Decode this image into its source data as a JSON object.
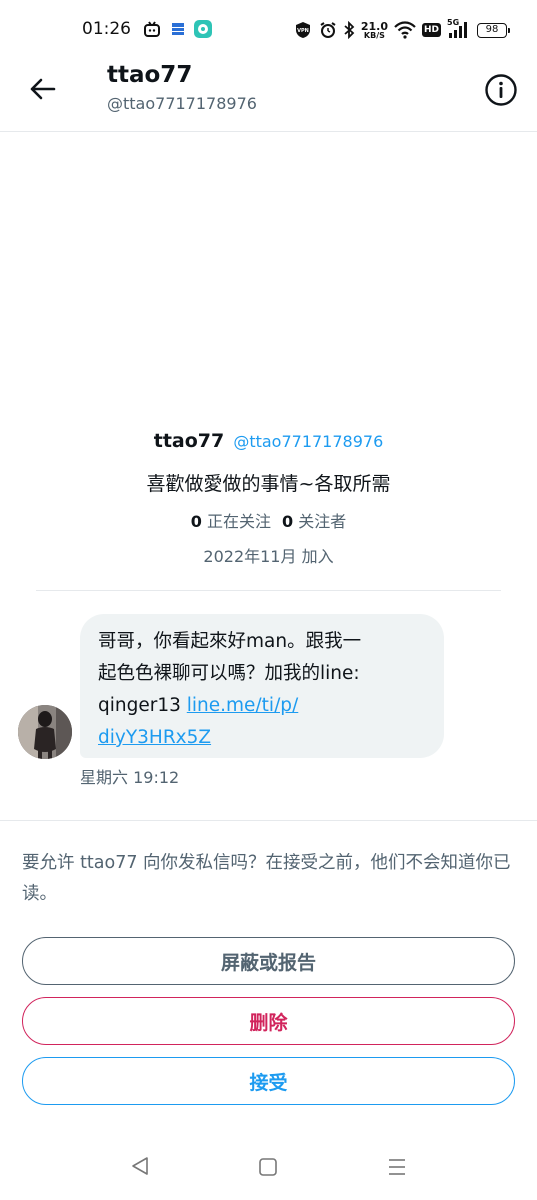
{
  "status_bar": {
    "time": "01:26",
    "net_speed_value": "21.0",
    "net_speed_unit": "KB/S",
    "hd_label": "HD",
    "signal_label": "5G",
    "battery": "98"
  },
  "header": {
    "name": "ttao77",
    "handle": "@ttao7717178976"
  },
  "profile": {
    "name": "ttao77",
    "handle": "@ttao7717178976",
    "bio": "喜歡做愛做的事情~各取所需",
    "following_count": "0",
    "following_label": "正在关注",
    "followers_count": "0",
    "followers_label": "关注者",
    "joined": "2022年11月 加入"
  },
  "message": {
    "text_line1": "哥哥，你看起來好man。跟我一",
    "text_line2": "起色色裸聊可以嗎？加我的line:",
    "text_line3_prefix": "qinger13 ",
    "link_part1": "line.me/ti/p/",
    "link_part2": "diyY3HRx5Z",
    "timestamp": "星期六 19:12"
  },
  "request": {
    "prompt": "要允许 ttao77 向你发私信吗？在接受之前，他们不会知道你已读。",
    "block_label": "屏蔽或报告",
    "delete_label": "删除",
    "accept_label": "接受"
  },
  "colors": {
    "accent": "#1d9bf0",
    "danger": "#d1245c",
    "muted": "#536471",
    "bubble": "#eff3f4"
  },
  "icons": {
    "back": "arrow-left-icon",
    "info": "info-circle-icon",
    "nav_back": "triangle-back-icon",
    "nav_home": "square-home-icon",
    "nav_menu": "menu-lines-icon"
  }
}
